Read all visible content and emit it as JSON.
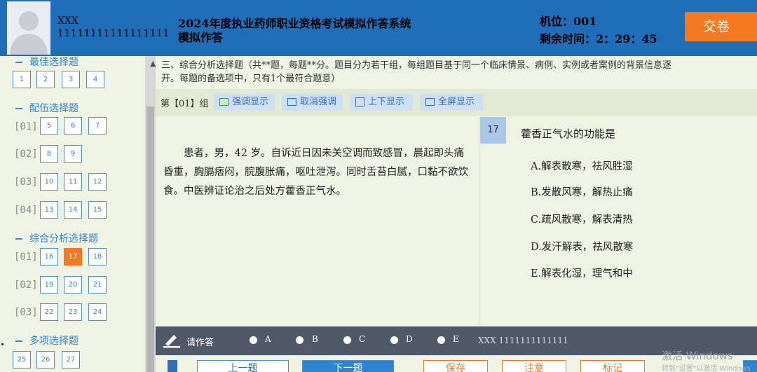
{
  "header": {
    "user_name": "XXX",
    "user_id": "11111111111111111",
    "title": "2024年度执业药师职业资格考试模拟作答系统",
    "subtitle": "模拟作答",
    "seat": "机位：001",
    "time_left": "剩余时间：2：29：45",
    "submit_label": "交卷"
  },
  "sidebar": {
    "sections": [
      {
        "title": "最佳选择题",
        "groups": [
          {
            "label": "",
            "items": [
              "1",
              "2",
              "3",
              "4"
            ]
          }
        ]
      },
      {
        "title": "配伍选择题",
        "groups": [
          {
            "label": "[01]",
            "items": [
              "5",
              "6",
              "7"
            ]
          },
          {
            "label": "[02]",
            "items": [
              "8",
              "9"
            ]
          },
          {
            "label": "[03]",
            "items": [
              "10",
              "11",
              "12"
            ]
          },
          {
            "label": "[04]",
            "items": [
              "13",
              "14",
              "15"
            ]
          }
        ]
      },
      {
        "title": "综合分析选择题",
        "groups": [
          {
            "label": "[01]",
            "items": [
              "16",
              "17",
              "18"
            ]
          },
          {
            "label": "[02]",
            "items": [
              "19",
              "20",
              "21"
            ]
          },
          {
            "label": "[03]",
            "items": [
              "22",
              "23",
              "24"
            ]
          }
        ]
      },
      {
        "title": "多项选择题",
        "groups": [
          {
            "label": "",
            "items": [
              "25",
              "26",
              "27"
            ]
          }
        ]
      }
    ],
    "active_item": "17"
  },
  "instructions": {
    "line1": "三、综合分析选择题（共**题，每题**分。题目分为若干组，每组题目基于同一个临床情景、病例、实例或者案例的背景信息逐",
    "line2": "开。每题的备选项中，只有1个最符合题意）"
  },
  "toolbar": {
    "group_no": "第【01】组",
    "emphasize": "强调显示",
    "cancel_emphasize": "取消强调",
    "vertical": "上下显示",
    "fullscreen": "全屏显示"
  },
  "question": {
    "stem": "患者，男，42 岁。自诉近日因未关空调而致感冒，晨起即头痛昏重，胸膈痞闷，脘腹胀痛，呕吐泄泻。同时舌苔白腻，口黏不欲饮食。中医辨证论治之后处方藿香正气水。",
    "number": "17",
    "title": "藿香正气水的功能是",
    "options": [
      "A.解表散寒，祛风胜湿",
      "B.发散风寒，解热止痛",
      "C.疏风散寒，解表清热",
      "D.发汗解表，祛风散寒",
      "E.解表化湿，理气和中"
    ]
  },
  "answer_bar": {
    "label": "请作答",
    "choices": [
      "A",
      "B",
      "C",
      "D",
      "E"
    ],
    "user": "XXX 1111111111111"
  },
  "bottom_nav": {
    "prev": "上一题",
    "next": "下一题",
    "b3": "保存",
    "b4": "注意",
    "b5": "标记"
  },
  "watermark": {
    "line1": "激活 Windows",
    "line2": "转到\"设置\"以激活 Windows"
  },
  "colors": {
    "header_blue": "#1e6eb8",
    "accent_orange": "#f47920",
    "link_blue": "#2f84d0"
  }
}
